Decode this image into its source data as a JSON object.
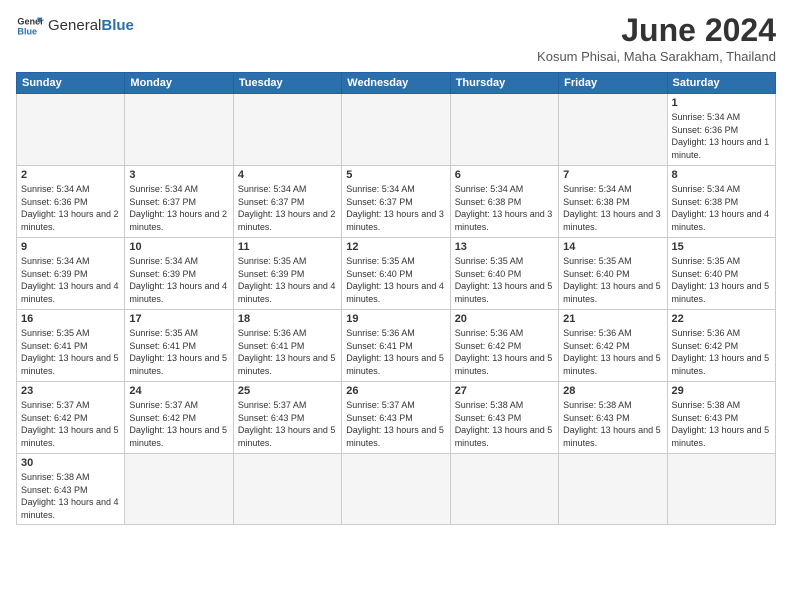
{
  "header": {
    "logo_general": "General",
    "logo_blue": "Blue",
    "month_title": "June 2024",
    "location": "Kosum Phisai, Maha Sarakham, Thailand"
  },
  "weekdays": [
    "Sunday",
    "Monday",
    "Tuesday",
    "Wednesday",
    "Thursday",
    "Friday",
    "Saturday"
  ],
  "weeks": [
    [
      {
        "day": "",
        "info": ""
      },
      {
        "day": "",
        "info": ""
      },
      {
        "day": "",
        "info": ""
      },
      {
        "day": "",
        "info": ""
      },
      {
        "day": "",
        "info": ""
      },
      {
        "day": "",
        "info": ""
      },
      {
        "day": "1",
        "info": "Sunrise: 5:34 AM\nSunset: 6:36 PM\nDaylight: 13 hours and 1 minute."
      }
    ],
    [
      {
        "day": "2",
        "info": "Sunrise: 5:34 AM\nSunset: 6:36 PM\nDaylight: 13 hours and 2 minutes."
      },
      {
        "day": "3",
        "info": "Sunrise: 5:34 AM\nSunset: 6:37 PM\nDaylight: 13 hours and 2 minutes."
      },
      {
        "day": "4",
        "info": "Sunrise: 5:34 AM\nSunset: 6:37 PM\nDaylight: 13 hours and 2 minutes."
      },
      {
        "day": "5",
        "info": "Sunrise: 5:34 AM\nSunset: 6:37 PM\nDaylight: 13 hours and 3 minutes."
      },
      {
        "day": "6",
        "info": "Sunrise: 5:34 AM\nSunset: 6:38 PM\nDaylight: 13 hours and 3 minutes."
      },
      {
        "day": "7",
        "info": "Sunrise: 5:34 AM\nSunset: 6:38 PM\nDaylight: 13 hours and 3 minutes."
      },
      {
        "day": "8",
        "info": "Sunrise: 5:34 AM\nSunset: 6:38 PM\nDaylight: 13 hours and 4 minutes."
      }
    ],
    [
      {
        "day": "9",
        "info": "Sunrise: 5:34 AM\nSunset: 6:39 PM\nDaylight: 13 hours and 4 minutes."
      },
      {
        "day": "10",
        "info": "Sunrise: 5:34 AM\nSunset: 6:39 PM\nDaylight: 13 hours and 4 minutes."
      },
      {
        "day": "11",
        "info": "Sunrise: 5:35 AM\nSunset: 6:39 PM\nDaylight: 13 hours and 4 minutes."
      },
      {
        "day": "12",
        "info": "Sunrise: 5:35 AM\nSunset: 6:40 PM\nDaylight: 13 hours and 4 minutes."
      },
      {
        "day": "13",
        "info": "Sunrise: 5:35 AM\nSunset: 6:40 PM\nDaylight: 13 hours and 5 minutes."
      },
      {
        "day": "14",
        "info": "Sunrise: 5:35 AM\nSunset: 6:40 PM\nDaylight: 13 hours and 5 minutes."
      },
      {
        "day": "15",
        "info": "Sunrise: 5:35 AM\nSunset: 6:40 PM\nDaylight: 13 hours and 5 minutes."
      }
    ],
    [
      {
        "day": "16",
        "info": "Sunrise: 5:35 AM\nSunset: 6:41 PM\nDaylight: 13 hours and 5 minutes."
      },
      {
        "day": "17",
        "info": "Sunrise: 5:35 AM\nSunset: 6:41 PM\nDaylight: 13 hours and 5 minutes."
      },
      {
        "day": "18",
        "info": "Sunrise: 5:36 AM\nSunset: 6:41 PM\nDaylight: 13 hours and 5 minutes."
      },
      {
        "day": "19",
        "info": "Sunrise: 5:36 AM\nSunset: 6:41 PM\nDaylight: 13 hours and 5 minutes."
      },
      {
        "day": "20",
        "info": "Sunrise: 5:36 AM\nSunset: 6:42 PM\nDaylight: 13 hours and 5 minutes."
      },
      {
        "day": "21",
        "info": "Sunrise: 5:36 AM\nSunset: 6:42 PM\nDaylight: 13 hours and 5 minutes."
      },
      {
        "day": "22",
        "info": "Sunrise: 5:36 AM\nSunset: 6:42 PM\nDaylight: 13 hours and 5 minutes."
      }
    ],
    [
      {
        "day": "23",
        "info": "Sunrise: 5:37 AM\nSunset: 6:42 PM\nDaylight: 13 hours and 5 minutes."
      },
      {
        "day": "24",
        "info": "Sunrise: 5:37 AM\nSunset: 6:42 PM\nDaylight: 13 hours and 5 minutes."
      },
      {
        "day": "25",
        "info": "Sunrise: 5:37 AM\nSunset: 6:43 PM\nDaylight: 13 hours and 5 minutes."
      },
      {
        "day": "26",
        "info": "Sunrise: 5:37 AM\nSunset: 6:43 PM\nDaylight: 13 hours and 5 minutes."
      },
      {
        "day": "27",
        "info": "Sunrise: 5:38 AM\nSunset: 6:43 PM\nDaylight: 13 hours and 5 minutes."
      },
      {
        "day": "28",
        "info": "Sunrise: 5:38 AM\nSunset: 6:43 PM\nDaylight: 13 hours and 5 minutes."
      },
      {
        "day": "29",
        "info": "Sunrise: 5:38 AM\nSunset: 6:43 PM\nDaylight: 13 hours and 5 minutes."
      }
    ],
    [
      {
        "day": "30",
        "info": "Sunrise: 5:38 AM\nSunset: 6:43 PM\nDaylight: 13 hours and 4 minutes."
      },
      {
        "day": "",
        "info": ""
      },
      {
        "day": "",
        "info": ""
      },
      {
        "day": "",
        "info": ""
      },
      {
        "day": "",
        "info": ""
      },
      {
        "day": "",
        "info": ""
      },
      {
        "day": "",
        "info": ""
      }
    ]
  ]
}
